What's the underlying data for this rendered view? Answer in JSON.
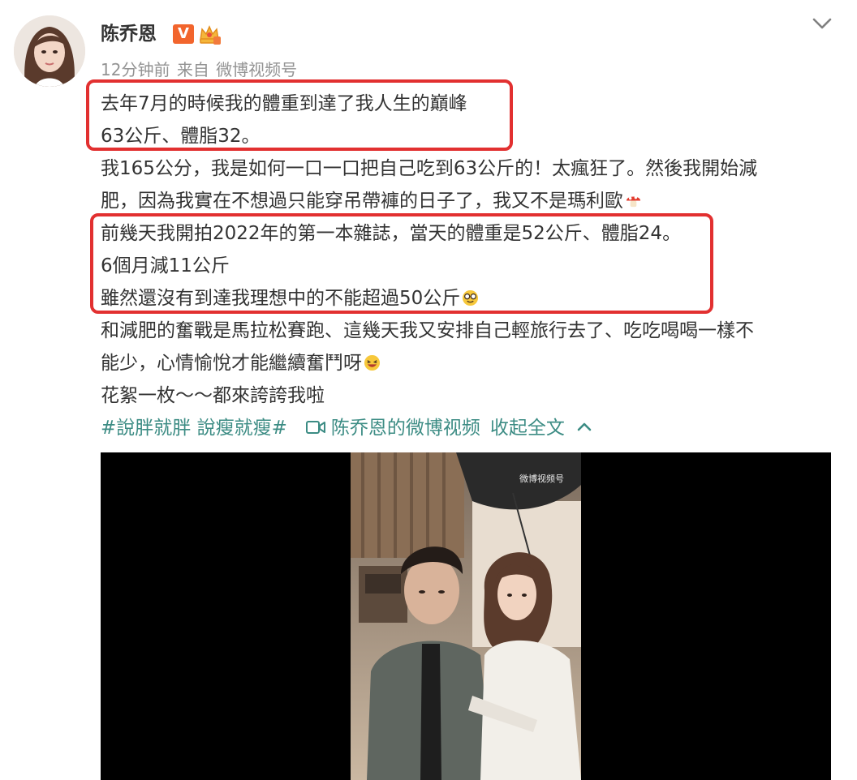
{
  "post": {
    "username": "陈乔恩",
    "verified_badge": "V",
    "time": "12分钟前",
    "source_prefix": "来自",
    "source": "微博视频号",
    "lines": [
      "去年7月的時候我的體重到達了我人生的巔峰",
      "63公斤、體脂32。",
      "我165公分，我是如何一口一口把自己吃到63公斤的！太瘋狂了。然後我開始減",
      "肥，因為我實在不想過只能穿吊帶褲的日子了，我又不是瑪利歐",
      "前幾天我開拍2022年的第一本雜誌，當天的體重是52公斤、體脂24。",
      "6個月減11公斤",
      "雖然還沒有到達我理想中的不能超過50公斤",
      "和減肥的奮戰是馬拉松賽跑、這幾天我又安排自己輕旅行去了、吃吃喝喝一樣不",
      "能少，心情愉悅才能繼續奮鬥呀",
      "花絮一枚～～都來誇誇我啦"
    ],
    "tags": {
      "hashtag": "#說胖就胖 說瘦就瘦#",
      "video_link": "陈乔恩的微博视频",
      "collapse": "收起全文"
    },
    "video": {
      "watermark": "微博视频号"
    },
    "icons": [
      "avatar",
      "verified-v-icon",
      "crown-badge-icon",
      "chevron-down-icon",
      "mushroom-emoji-icon",
      "nerd-emoji-icon",
      "grin-emoji-icon",
      "video-icon",
      "chevron-up-icon"
    ],
    "colors": {
      "highlight_box": "#e23030",
      "link": "#3c8c84",
      "meta": "#939393",
      "badge": "#f2652d"
    }
  }
}
